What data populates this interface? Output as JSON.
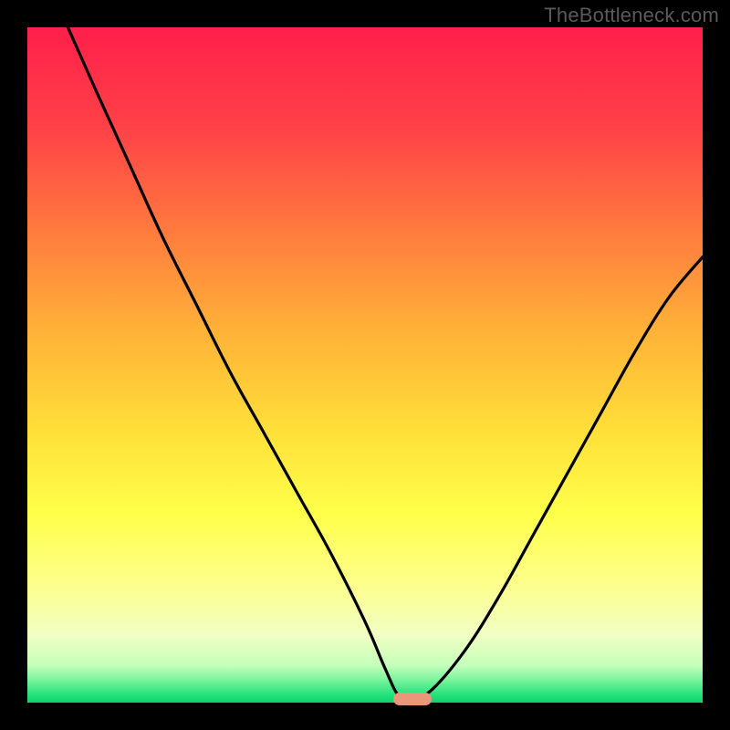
{
  "watermark": "TheBottleneck.com",
  "chart_data": {
    "type": "line",
    "title": "",
    "xlabel": "",
    "ylabel": "",
    "xlim": [
      0,
      100
    ],
    "ylim": [
      0,
      100
    ],
    "grid": false,
    "legend": false,
    "series": [
      {
        "name": "bottleneck-curve",
        "x": [
          6,
          10,
          15,
          20,
          25,
          30,
          35,
          40,
          45,
          50,
          53,
          55,
          57,
          60,
          65,
          70,
          75,
          80,
          85,
          90,
          95,
          100
        ],
        "values": [
          100,
          91,
          80,
          69,
          59,
          49,
          40,
          31,
          22,
          12,
          5,
          1,
          0.5,
          2,
          8,
          16,
          25,
          34,
          43,
          52,
          60,
          66
        ]
      }
    ],
    "marker": {
      "x": 57,
      "y": 0.5,
      "color": "#e9967a"
    },
    "gradient_stops": [
      {
        "offset": 0.0,
        "color": "#ff1f4b"
      },
      {
        "offset": 0.15,
        "color": "#ff4247"
      },
      {
        "offset": 0.3,
        "color": "#ff7a3e"
      },
      {
        "offset": 0.45,
        "color": "#ffb238"
      },
      {
        "offset": 0.6,
        "color": "#ffe039"
      },
      {
        "offset": 0.72,
        "color": "#ffff4a"
      },
      {
        "offset": 0.82,
        "color": "#fdff89"
      },
      {
        "offset": 0.9,
        "color": "#f2ffc3"
      },
      {
        "offset": 0.945,
        "color": "#c4ffbb"
      },
      {
        "offset": 0.965,
        "color": "#7ff59f"
      },
      {
        "offset": 0.99,
        "color": "#1fe07a"
      },
      {
        "offset": 1.0,
        "color": "#17cc6d"
      }
    ]
  }
}
